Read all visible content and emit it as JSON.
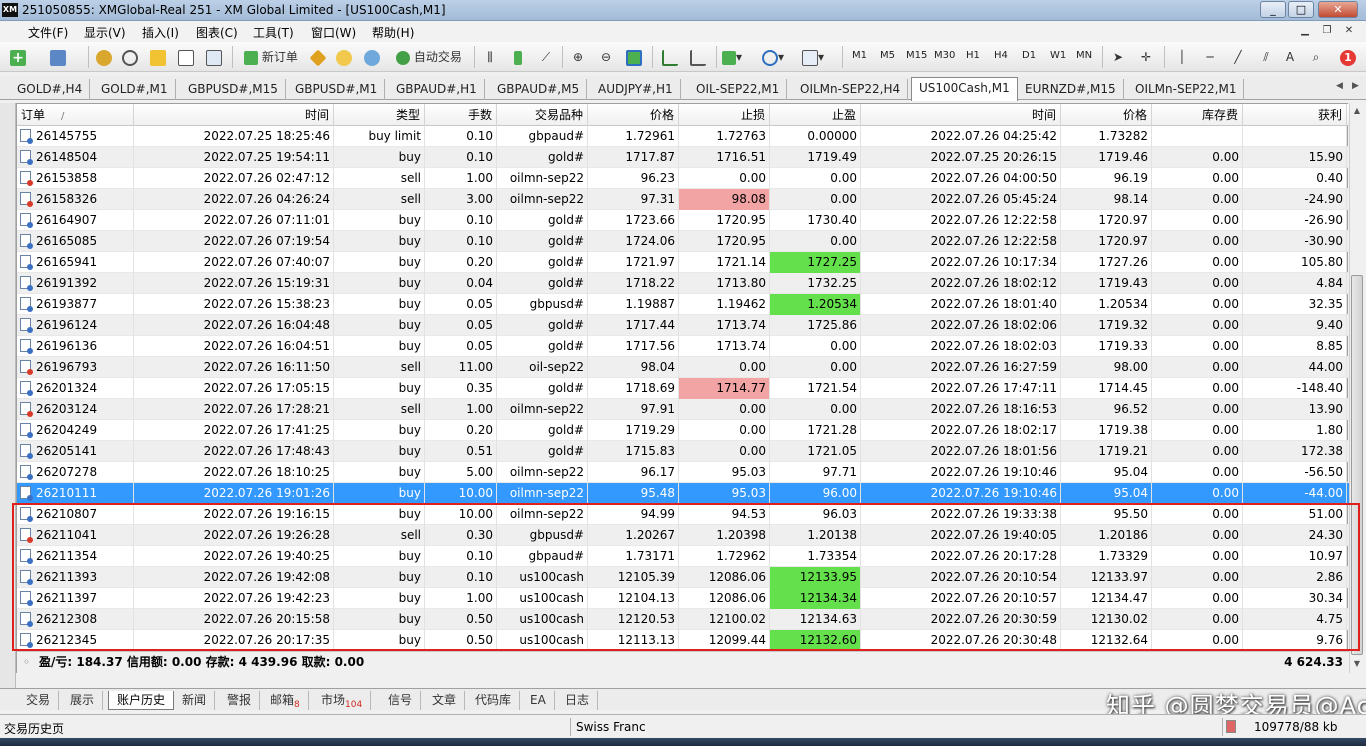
{
  "window": {
    "logo": "XM",
    "title": "251050855: XMGlobal-Real 251 - XM Global Limited - [US100Cash,M1]",
    "buttons": [
      "_",
      "□",
      "✕"
    ]
  },
  "menu": [
    "文件(F)",
    "显示(V)",
    "插入(I)",
    "图表(C)",
    "工具(T)",
    "窗口(W)",
    "帮助(H)"
  ],
  "toolbar": {
    "new_order": "新订单",
    "auto_trade": "自动交易",
    "timeframes": [
      "M1",
      "M5",
      "M15",
      "M30",
      "H1",
      "H4",
      "D1",
      "W1",
      "MN"
    ],
    "badge": "1"
  },
  "chart_tabs": {
    "items": [
      "GOLD#,H4",
      "GOLD#,M1",
      "GBPUSD#,M15",
      "GBPUSD#,M1",
      "GBPAUD#,H1",
      "GBPAUD#,M5",
      "AUDJPY#,H1",
      "OIL-SEP22,M1",
      "OILMn-SEP22,H4",
      "US100Cash,M1",
      "EURNZD#,M15",
      "OILMn-SEP22,M1"
    ],
    "active_index": 9
  },
  "table": {
    "headers": [
      "订单",
      "时间",
      "类型",
      "手数",
      "交易品种",
      "价格",
      "止损",
      "止盈",
      "时间",
      "价格",
      "库存费",
      "获利"
    ],
    "sort_mark": "/",
    "rows": [
      {
        "ticket": "26145755",
        "open_time": "2022.07.25 18:25:46",
        "type": "buy limit",
        "lots": "0.10",
        "symbol": "gbpaud#",
        "open_price": "1.72961",
        "sl": "1.72763",
        "tp": "0.00000",
        "close_time": "2022.07.26 04:25:42",
        "close_price": "1.73282",
        "swap": "",
        "profit": "",
        "sl_hl": "",
        "tp_hl": ""
      },
      {
        "ticket": "26148504",
        "open_time": "2022.07.25 19:54:11",
        "type": "buy",
        "lots": "0.10",
        "symbol": "gold#",
        "open_price": "1717.87",
        "sl": "1716.51",
        "tp": "1719.49",
        "close_time": "2022.07.25 20:26:15",
        "close_price": "1719.46",
        "swap": "0.00",
        "profit": "15.90",
        "sl_hl": "",
        "tp_hl": ""
      },
      {
        "ticket": "26153858",
        "open_time": "2022.07.26 02:47:12",
        "type": "sell",
        "lots": "1.00",
        "symbol": "oilmn-sep22",
        "open_price": "96.23",
        "sl": "0.00",
        "tp": "0.00",
        "close_time": "2022.07.26 04:00:50",
        "close_price": "96.19",
        "swap": "0.00",
        "profit": "0.40",
        "sl_hl": "",
        "tp_hl": ""
      },
      {
        "ticket": "26158326",
        "open_time": "2022.07.26 04:26:24",
        "type": "sell",
        "lots": "3.00",
        "symbol": "oilmn-sep22",
        "open_price": "97.31",
        "sl": "98.08",
        "tp": "0.00",
        "close_time": "2022.07.26 05:45:24",
        "close_price": "98.14",
        "swap": "0.00",
        "profit": "-24.90",
        "sl_hl": "red",
        "tp_hl": ""
      },
      {
        "ticket": "26164907",
        "open_time": "2022.07.26 07:11:01",
        "type": "buy",
        "lots": "0.10",
        "symbol": "gold#",
        "open_price": "1723.66",
        "sl": "1720.95",
        "tp": "1730.40",
        "close_time": "2022.07.26 12:22:58",
        "close_price": "1720.97",
        "swap": "0.00",
        "profit": "-26.90",
        "sl_hl": "",
        "tp_hl": ""
      },
      {
        "ticket": "26165085",
        "open_time": "2022.07.26 07:19:54",
        "type": "buy",
        "lots": "0.10",
        "symbol": "gold#",
        "open_price": "1724.06",
        "sl": "1720.95",
        "tp": "0.00",
        "close_time": "2022.07.26 12:22:58",
        "close_price": "1720.97",
        "swap": "0.00",
        "profit": "-30.90",
        "sl_hl": "",
        "tp_hl": ""
      },
      {
        "ticket": "26165941",
        "open_time": "2022.07.26 07:40:07",
        "type": "buy",
        "lots": "0.20",
        "symbol": "gold#",
        "open_price": "1721.97",
        "sl": "1721.14",
        "tp": "1727.25",
        "close_time": "2022.07.26 10:17:34",
        "close_price": "1727.26",
        "swap": "0.00",
        "profit": "105.80",
        "sl_hl": "",
        "tp_hl": "green"
      },
      {
        "ticket": "26191392",
        "open_time": "2022.07.26 15:19:31",
        "type": "buy",
        "lots": "0.04",
        "symbol": "gold#",
        "open_price": "1718.22",
        "sl": "1713.80",
        "tp": "1732.25",
        "close_time": "2022.07.26 18:02:12",
        "close_price": "1719.43",
        "swap": "0.00",
        "profit": "4.84",
        "sl_hl": "",
        "tp_hl": ""
      },
      {
        "ticket": "26193877",
        "open_time": "2022.07.26 15:38:23",
        "type": "buy",
        "lots": "0.05",
        "symbol": "gbpusd#",
        "open_price": "1.19887",
        "sl": "1.19462",
        "tp": "1.20534",
        "close_time": "2022.07.26 18:01:40",
        "close_price": "1.20534",
        "swap": "0.00",
        "profit": "32.35",
        "sl_hl": "",
        "tp_hl": "green"
      },
      {
        "ticket": "26196124",
        "open_time": "2022.07.26 16:04:48",
        "type": "buy",
        "lots": "0.05",
        "symbol": "gold#",
        "open_price": "1717.44",
        "sl": "1713.74",
        "tp": "1725.86",
        "close_time": "2022.07.26 18:02:06",
        "close_price": "1719.32",
        "swap": "0.00",
        "profit": "9.40",
        "sl_hl": "",
        "tp_hl": ""
      },
      {
        "ticket": "26196136",
        "open_time": "2022.07.26 16:04:51",
        "type": "buy",
        "lots": "0.05",
        "symbol": "gold#",
        "open_price": "1717.56",
        "sl": "1713.74",
        "tp": "0.00",
        "close_time": "2022.07.26 18:02:03",
        "close_price": "1719.33",
        "swap": "0.00",
        "profit": "8.85",
        "sl_hl": "",
        "tp_hl": ""
      },
      {
        "ticket": "26196793",
        "open_time": "2022.07.26 16:11:50",
        "type": "sell",
        "lots": "11.00",
        "symbol": "oil-sep22",
        "open_price": "98.04",
        "sl": "0.00",
        "tp": "0.00",
        "close_time": "2022.07.26 16:27:59",
        "close_price": "98.00",
        "swap": "0.00",
        "profit": "44.00",
        "sl_hl": "",
        "tp_hl": ""
      },
      {
        "ticket": "26201324",
        "open_time": "2022.07.26 17:05:15",
        "type": "buy",
        "lots": "0.35",
        "symbol": "gold#",
        "open_price": "1718.69",
        "sl": "1714.77",
        "tp": "1721.54",
        "close_time": "2022.07.26 17:47:11",
        "close_price": "1714.45",
        "swap": "0.00",
        "profit": "-148.40",
        "sl_hl": "red",
        "tp_hl": ""
      },
      {
        "ticket": "26203124",
        "open_time": "2022.07.26 17:28:21",
        "type": "sell",
        "lots": "1.00",
        "symbol": "oilmn-sep22",
        "open_price": "97.91",
        "sl": "0.00",
        "tp": "0.00",
        "close_time": "2022.07.26 18:16:53",
        "close_price": "96.52",
        "swap": "0.00",
        "profit": "13.90",
        "sl_hl": "",
        "tp_hl": ""
      },
      {
        "ticket": "26204249",
        "open_time": "2022.07.26 17:41:25",
        "type": "buy",
        "lots": "0.20",
        "symbol": "gold#",
        "open_price": "1719.29",
        "sl": "0.00",
        "tp": "1721.28",
        "close_time": "2022.07.26 18:02:17",
        "close_price": "1719.38",
        "swap": "0.00",
        "profit": "1.80",
        "sl_hl": "",
        "tp_hl": ""
      },
      {
        "ticket": "26205141",
        "open_time": "2022.07.26 17:48:43",
        "type": "buy",
        "lots": "0.51",
        "symbol": "gold#",
        "open_price": "1715.83",
        "sl": "0.00",
        "tp": "1721.05",
        "close_time": "2022.07.26 18:01:56",
        "close_price": "1719.21",
        "swap": "0.00",
        "profit": "172.38",
        "sl_hl": "",
        "tp_hl": ""
      },
      {
        "ticket": "26207278",
        "open_time": "2022.07.26 18:10:25",
        "type": "buy",
        "lots": "5.00",
        "symbol": "oilmn-sep22",
        "open_price": "96.17",
        "sl": "95.03",
        "tp": "97.71",
        "close_time": "2022.07.26 19:10:46",
        "close_price": "95.04",
        "swap": "0.00",
        "profit": "-56.50",
        "sl_hl": "",
        "tp_hl": ""
      },
      {
        "ticket": "26210111",
        "open_time": "2022.07.26 19:01:26",
        "type": "buy",
        "lots": "10.00",
        "symbol": "oilmn-sep22",
        "open_price": "95.48",
        "sl": "95.03",
        "tp": "96.00",
        "close_time": "2022.07.26 19:10:46",
        "close_price": "95.04",
        "swap": "0.00",
        "profit": "-44.00",
        "sl_hl": "",
        "tp_hl": ""
      },
      {
        "ticket": "26210807",
        "open_time": "2022.07.26 19:16:15",
        "type": "buy",
        "lots": "10.00",
        "symbol": "oilmn-sep22",
        "open_price": "94.99",
        "sl": "94.53",
        "tp": "96.03",
        "close_time": "2022.07.26 19:33:38",
        "close_price": "95.50",
        "swap": "0.00",
        "profit": "51.00",
        "sl_hl": "",
        "tp_hl": ""
      },
      {
        "ticket": "26211041",
        "open_time": "2022.07.26 19:26:28",
        "type": "sell",
        "lots": "0.30",
        "symbol": "gbpusd#",
        "open_price": "1.20267",
        "sl": "1.20398",
        "tp": "1.20138",
        "close_time": "2022.07.26 19:40:05",
        "close_price": "1.20186",
        "swap": "0.00",
        "profit": "24.30",
        "sl_hl": "",
        "tp_hl": ""
      },
      {
        "ticket": "26211354",
        "open_time": "2022.07.26 19:40:25",
        "type": "buy",
        "lots": "0.10",
        "symbol": "gbpaud#",
        "open_price": "1.73171",
        "sl": "1.72962",
        "tp": "1.73354",
        "close_time": "2022.07.26 20:17:28",
        "close_price": "1.73329",
        "swap": "0.00",
        "profit": "10.97",
        "sl_hl": "",
        "tp_hl": ""
      },
      {
        "ticket": "26211393",
        "open_time": "2022.07.26 19:42:08",
        "type": "buy",
        "lots": "0.10",
        "symbol": "us100cash",
        "open_price": "12105.39",
        "sl": "12086.06",
        "tp": "12133.95",
        "close_time": "2022.07.26 20:10:54",
        "close_price": "12133.97",
        "swap": "0.00",
        "profit": "2.86",
        "sl_hl": "",
        "tp_hl": "green"
      },
      {
        "ticket": "26211397",
        "open_time": "2022.07.26 19:42:23",
        "type": "buy",
        "lots": "1.00",
        "symbol": "us100cash",
        "open_price": "12104.13",
        "sl": "12086.06",
        "tp": "12134.34",
        "close_time": "2022.07.26 20:10:57",
        "close_price": "12134.47",
        "swap": "0.00",
        "profit": "30.34",
        "sl_hl": "",
        "tp_hl": "green"
      },
      {
        "ticket": "26212308",
        "open_time": "2022.07.26 20:15:58",
        "type": "buy",
        "lots": "0.50",
        "symbol": "us100cash",
        "open_price": "12120.53",
        "sl": "12100.02",
        "tp": "12134.63",
        "close_time": "2022.07.26 20:30:59",
        "close_price": "12130.02",
        "swap": "0.00",
        "profit": "4.75",
        "sl_hl": "",
        "tp_hl": ""
      },
      {
        "ticket": "26212345",
        "open_time": "2022.07.26 20:17:35",
        "type": "buy",
        "lots": "0.50",
        "symbol": "us100cash",
        "open_price": "12113.13",
        "sl": "12099.44",
        "tp": "12132.60",
        "close_time": "2022.07.26 20:30:48",
        "close_price": "12132.64",
        "swap": "0.00",
        "profit": "9.76",
        "sl_hl": "",
        "tp_hl": "green"
      }
    ],
    "selected_ticket": "26210111"
  },
  "summary": {
    "text": "盈/亏: 184.37  信用额: 0.00  存款: 4 439.96  取款: 0.00",
    "total": "4 624.33"
  },
  "terminal_tabs": [
    {
      "label": "交易",
      "badge": ""
    },
    {
      "label": "展示",
      "badge": ""
    },
    {
      "label": "账户历史",
      "badge": ""
    },
    {
      "label": "新闻",
      "badge": ""
    },
    {
      "label": "警报",
      "badge": ""
    },
    {
      "label": "邮箱",
      "badge": "8"
    },
    {
      "label": "市场",
      "badge": "104"
    },
    {
      "label": "信号",
      "badge": ""
    },
    {
      "label": "文章",
      "badge": ""
    },
    {
      "label": "代码库",
      "badge": ""
    },
    {
      "label": "EA",
      "badge": ""
    },
    {
      "label": "日志",
      "badge": ""
    }
  ],
  "active_terminal_tab": 2,
  "watermark": "知乎 @圆梦交易员@Ac",
  "status": {
    "left": "交易历史页",
    "mid": "Swiss Franc",
    "right": "109778/88 kb"
  },
  "colors": {
    "selection": "#3399ff",
    "tp_hit": "#64e04c",
    "sl_hit": "#f2a3a3",
    "highlight_box": "#e0201c"
  }
}
